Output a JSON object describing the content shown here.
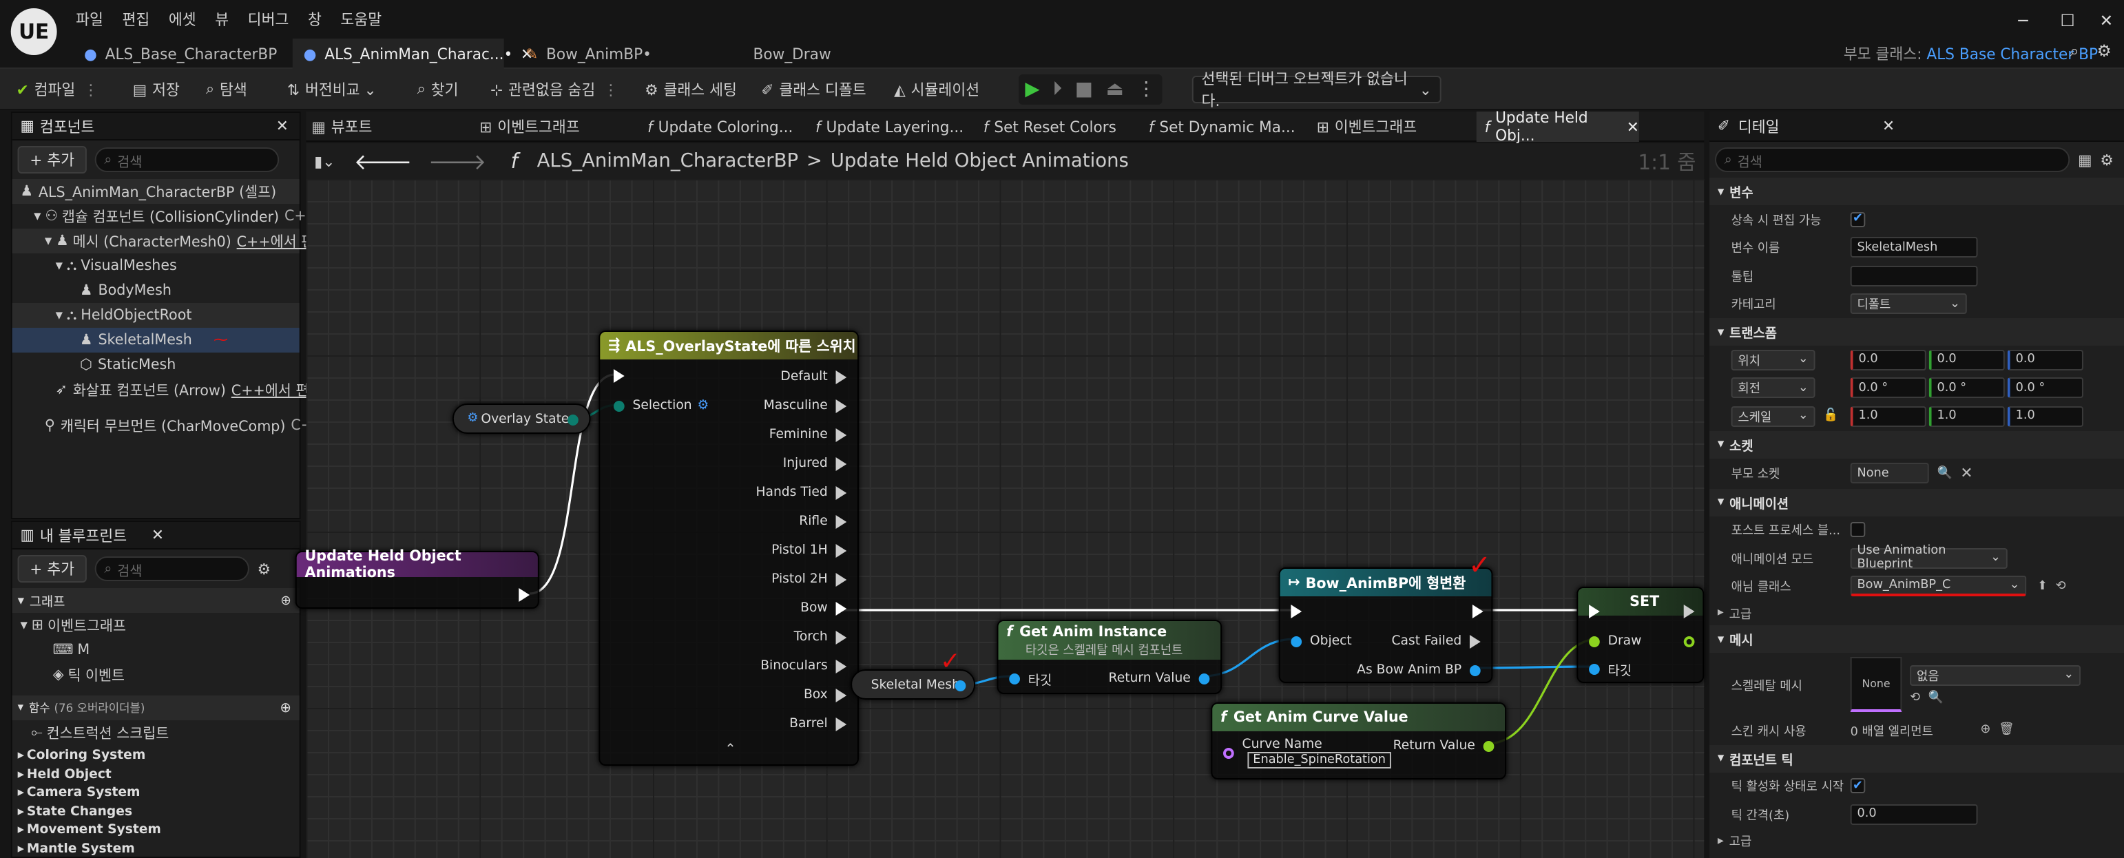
{
  "app": {
    "logo": "UE",
    "menu": [
      "파일",
      "편집",
      "에셋",
      "뷰",
      "디버그",
      "창",
      "도움말"
    ]
  },
  "doc_tabs": [
    {
      "label": "ALS_Base_CharacterBP"
    },
    {
      "label": "ALS_AnimMan_Charac...•"
    },
    {
      "label": "Bow_AnimBP•"
    },
    {
      "label": "Bow_Draw"
    }
  ],
  "parent_class": {
    "label": "부모 클래스:",
    "value": "ALS Base Character BP"
  },
  "toolbar": {
    "compile": "컴파일",
    "save": "저장",
    "browse": "탐색",
    "diff": "버전비교",
    "find": "찾기",
    "hide_unrelated": "관련없음 숨김",
    "class_settings": "클래스 세팅",
    "class_defaults": "클래스 디폴트",
    "simulation": "시뮬레이션",
    "debug_object": "선택된 디버그 오브젝트가 없습니다."
  },
  "components": {
    "title": "컴포넌트",
    "add": "+ 추가",
    "search_placeholder": "검색",
    "items": [
      "ALS_AnimMan_CharacterBP (셀프)",
      "캡슐 컴포넌트 (CollisionCylinder)",
      "C++",
      "메시 (CharacterMesh0)",
      "C++에서 편",
      "VisualMeshes",
      "BodyMesh",
      "HeldObjectRoot",
      "SkeletalMesh",
      "StaticMesh",
      "화살표 컴포넌트 (Arrow)",
      "C++에서 편",
      "캐릭터 무브먼트 (CharMoveComp)",
      "C+"
    ]
  },
  "blueprint": {
    "title": "내 블루프린트",
    "add": "+ 추가",
    "search_placeholder": "검색",
    "graph_section": "그래프",
    "event_graph": "이벤트그래프",
    "m": "M",
    "tick": "틱 이벤트",
    "functions_section": "함수",
    "functions_count": "(76 오버라이더블)",
    "construction": "컨스트럭션 스크립트",
    "categories": [
      "Coloring System",
      "Held Object",
      "Camera System",
      "State Changes",
      "Movement System",
      "Mantle System"
    ]
  },
  "graph_tabs": [
    "뷰포트",
    "이벤트그래프",
    "Update Coloring...",
    "Update Layering...",
    "Set Reset Colors",
    "Set Dynamic Ma...",
    "이벤트그래프",
    "Update Held Obj..."
  ],
  "breadcrumb": {
    "root": "ALS_AnimMan_CharacterBP",
    "sep": ">",
    "current": "Update Held Object Animations",
    "zoom": "1:1 줌"
  },
  "nodes": {
    "func_entry": "Update Held Object Animations",
    "overlay_state": "Overlay State",
    "switch_title": "ALS_OverlayState에 따른 스위치",
    "selection": "Selection",
    "switch_outputs": [
      "Default",
      "Masculine",
      "Feminine",
      "Injured",
      "Hands Tied",
      "Rifle",
      "Pistol 1H",
      "Pistol 2H",
      "Bow",
      "Torch",
      "Binoculars",
      "Box",
      "Barrel"
    ],
    "skeletal_mesh": "Skeletal Mesh",
    "get_anim_instance": "Get Anim Instance",
    "get_anim_instance_sub": "타깃은 스켈레탈 메시 컴포넌트",
    "target": "타깃",
    "return_value": "Return Value",
    "cast_title": "Bow_AnimBP에 형변환",
    "object": "Object",
    "cast_failed": "Cast Failed",
    "as_bow": "As Bow Anim BP",
    "set_title": "SET",
    "draw": "Draw",
    "curve_title": "Get Anim Curve Value",
    "curve_name": "Curve Name",
    "curve_value": "Enable_SpineRotation"
  },
  "details": {
    "title": "디테일",
    "search_placeholder": "검색",
    "sec_variable": "변수",
    "editable": "상속 시 편집 가능",
    "var_name_label": "변수 이름",
    "var_name": "SkeletalMesh",
    "tooltip": "툴팁",
    "category": "카테고리",
    "category_value": "디폴트",
    "sec_transform": "트랜스폼",
    "location": "위치",
    "rotation": "회전",
    "scale": "스케일",
    "loc": [
      "0.0",
      "0.0",
      "0.0"
    ],
    "rot": [
      "0.0 °",
      "0.0 °",
      "0.0 °"
    ],
    "scl": [
      "1.0",
      "1.0",
      "1.0"
    ],
    "sec_socket": "소켓",
    "parent_socket": "부모 소켓",
    "socket_value": "None",
    "sec_anim": "애니메이션",
    "post_process": "포스트 프로세스 블...",
    "anim_mode_label": "애니메이션 모드",
    "anim_mode": "Use Animation Blueprint",
    "anim_class_label": "애님 클래스",
    "anim_class": "Bow_AnimBP_C",
    "advanced": "고급",
    "sec_mesh": "메시",
    "skeletal_mesh_label": "스켈레탈 메시",
    "none": "None",
    "none_kr": "없음",
    "skin_cache": "스킨 캐시 사용",
    "skin_cache_value": "0 배열 엘리먼트",
    "sec_tick": "컴포넌트 틱",
    "tick_start": "틱 활성화 상태로 시작",
    "tick_interval": "틱 간격(초)",
    "tick_interval_value": "0.0"
  },
  "colors": {
    "exec": "#ffffff",
    "object_pin": "#1fa0f0",
    "bool_pin": "#8cd31f",
    "byte_pin": "#0c7d6e",
    "annotation": "#e01010"
  }
}
